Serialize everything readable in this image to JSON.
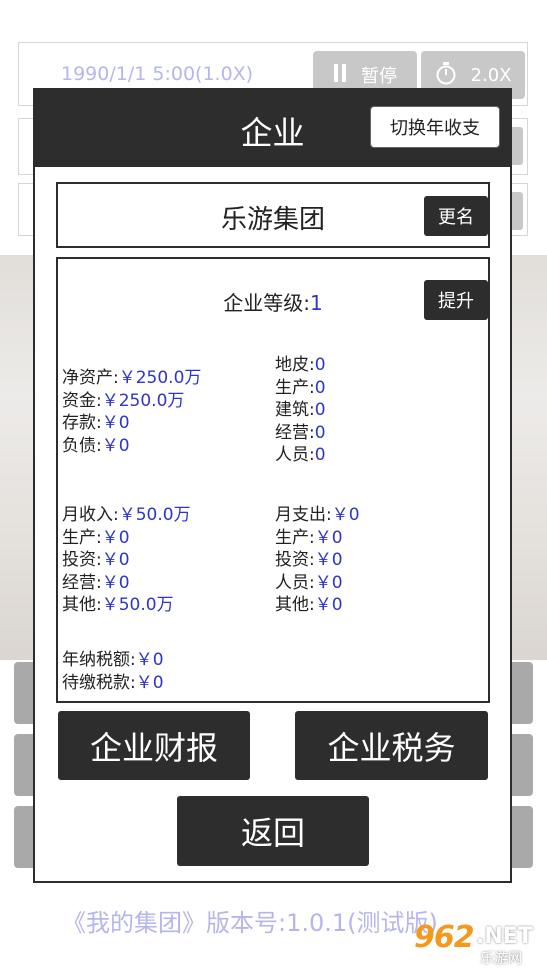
{
  "status_bar": {
    "datetime": "1990/1/1 5:00(1.0X)",
    "pause_icon": "pause-icon",
    "pause_label": "暂停",
    "speed_icon": "stopwatch-icon",
    "speed_label": "2.0X"
  },
  "modal": {
    "title": "企业",
    "toggle_year_label": "切换年收支",
    "company_name": "乐游集团",
    "rename_label": "更名",
    "level_label": "企业等级:",
    "level_value": "1",
    "upgrade_label": "提升",
    "assets": [
      {
        "label": "净资产:",
        "value": "￥250.0万"
      },
      {
        "label": "资金:",
        "value": "￥250.0万"
      },
      {
        "label": "存款:",
        "value": "￥0"
      },
      {
        "label": "负债:",
        "value": "￥0"
      }
    ],
    "properties": [
      {
        "label": "地皮:",
        "value": "0"
      },
      {
        "label": "生产:",
        "value": "0"
      },
      {
        "label": "建筑:",
        "value": "0"
      },
      {
        "label": "经营:",
        "value": "0"
      },
      {
        "label": "人员:",
        "value": "0"
      }
    ],
    "income": [
      {
        "label": "月收入:",
        "value": "￥50.0万"
      },
      {
        "label": "生产:",
        "value": "￥0"
      },
      {
        "label": "投资:",
        "value": "￥0"
      },
      {
        "label": "经营:",
        "value": "￥0"
      },
      {
        "label": "其他:",
        "value": "￥50.0万"
      }
    ],
    "expense": [
      {
        "label": "月支出:",
        "value": "￥0"
      },
      {
        "label": "生产:",
        "value": "￥0"
      },
      {
        "label": "投资:",
        "value": "￥0"
      },
      {
        "label": "人员:",
        "value": "￥0"
      },
      {
        "label": "其他:",
        "value": "￥0"
      }
    ],
    "tax": [
      {
        "label": "年纳税额:",
        "value": "￥0"
      },
      {
        "label": "待缴税款:",
        "value": "￥0"
      }
    ],
    "report_label": "企业财报",
    "tax_label": "企业税务",
    "back_label": "返回"
  },
  "footer": {
    "open_quote": "《",
    "game_name": "我的集团",
    "close_quote": "》",
    "version_label": "版本号:",
    "version_value": "1.0.1",
    "build_tag": "(测试版)"
  },
  "watermark": {
    "number": "962",
    "net": ".NET",
    "site": "乐游网"
  },
  "colors": {
    "dark": "#2d2d2d",
    "value_blue": "#2f35c8",
    "faded_text": "#b6b6ee"
  }
}
